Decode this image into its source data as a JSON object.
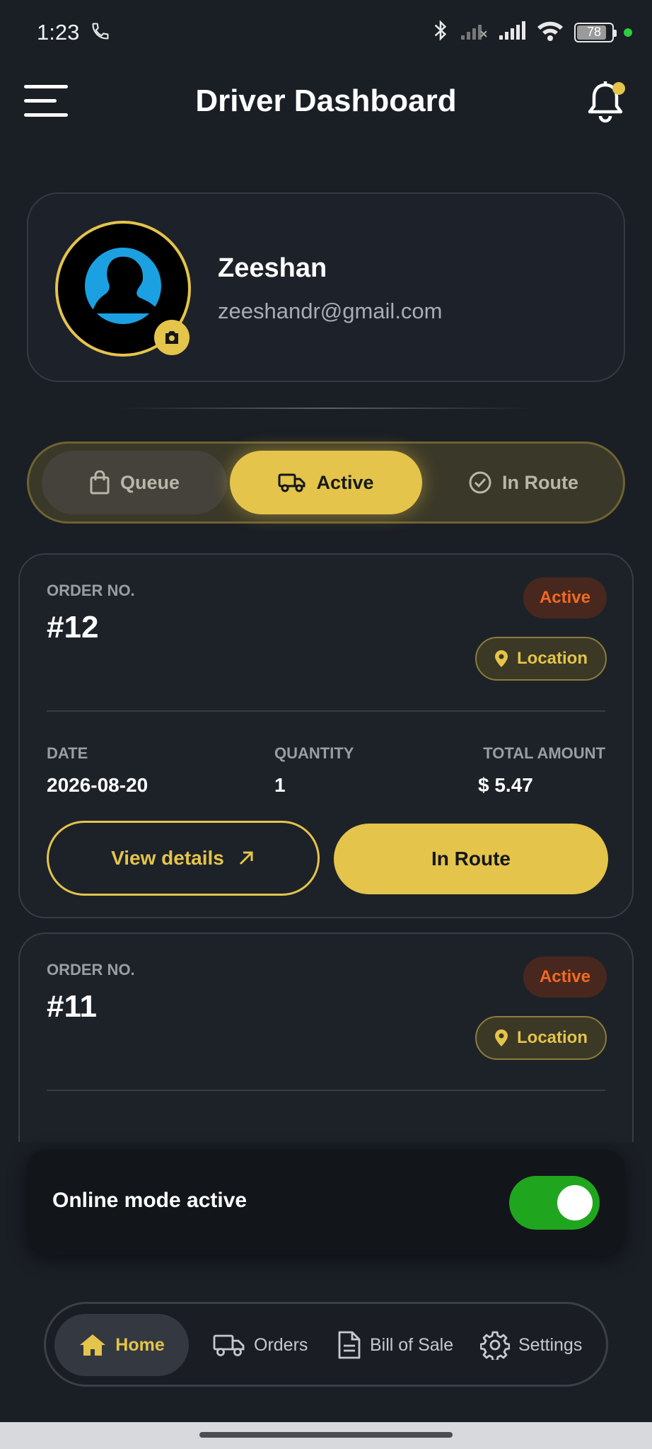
{
  "status_bar": {
    "time": "1:23",
    "battery": "78"
  },
  "header": {
    "title": "Driver Dashboard"
  },
  "profile": {
    "name": "Zeeshan",
    "email": "zeeshandr@gmail.com"
  },
  "tabs": [
    {
      "label": "Queue",
      "icon": "bag-icon"
    },
    {
      "label": "Active",
      "icon": "truck-icon",
      "selected": true
    },
    {
      "label": "In Route",
      "icon": "check-circle-icon"
    }
  ],
  "orders": [
    {
      "label": "ORDER NO.",
      "number": "#12",
      "status": "Active",
      "location_label": "Location",
      "date_label": "DATE",
      "date": "2026-08-20",
      "quantity_label": "QUANTITY",
      "quantity": "1",
      "total_label": "TOTAL AMOUNT",
      "total": "$ 5.47",
      "view_label": "View details",
      "route_label": "In Route"
    },
    {
      "label": "ORDER NO.",
      "number": "#11",
      "status": "Active",
      "location_label": "Location"
    }
  ],
  "online_mode": {
    "label": "Online mode active",
    "enabled": true
  },
  "nav": [
    {
      "label": "Home",
      "icon": "home-icon",
      "selected": true
    },
    {
      "label": "Orders",
      "icon": "truck-icon"
    },
    {
      "label": "Bill of Sale",
      "icon": "document-icon"
    },
    {
      "label": "Settings",
      "icon": "gear-icon"
    }
  ],
  "colors": {
    "accent": "#e4c44a",
    "background": "#1a1e25",
    "status_active": "#f26a21",
    "toggle_on": "#20a61e"
  }
}
